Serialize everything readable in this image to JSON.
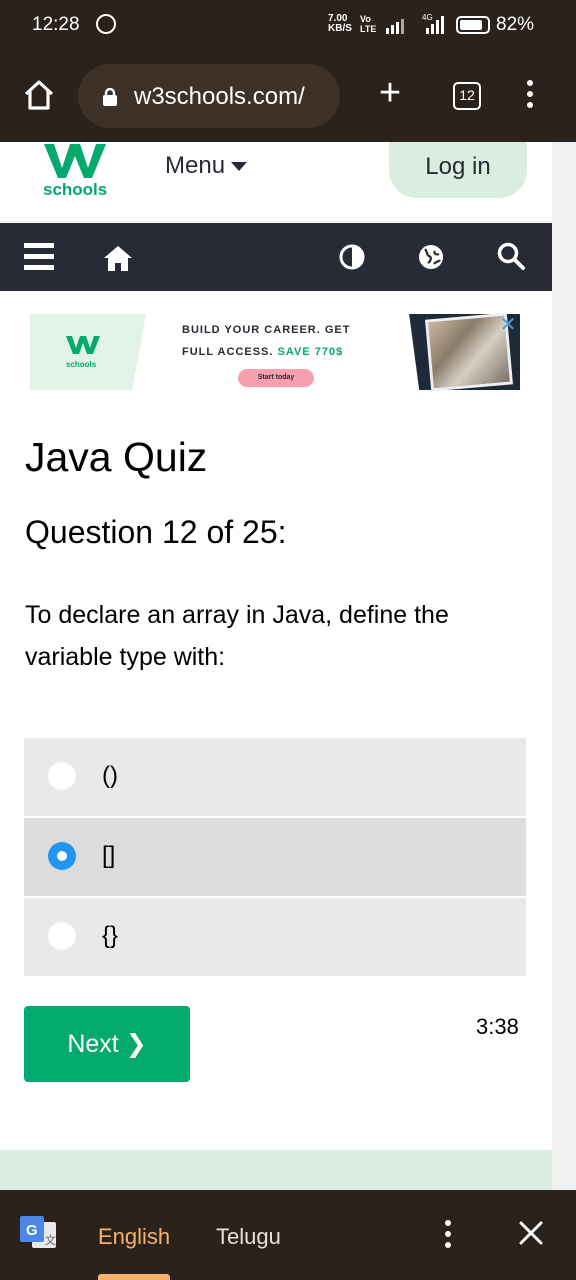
{
  "status_bar": {
    "time": "12:28",
    "net_speed_line1": "7.00",
    "net_speed_line2": "KB/S",
    "volte_line1": "Vo",
    "volte_line2": "LTE",
    "network_type": "4G",
    "battery": "82%"
  },
  "browser": {
    "url": "w3schools.com/",
    "tab_count": "12"
  },
  "site": {
    "logo_text": "schools",
    "menu_label": "Menu",
    "login_label": "Log in"
  },
  "ad": {
    "logo_text": "schools",
    "line1": "BUILD YOUR CAREER. GET",
    "line2_prefix": "FULL ACCESS.",
    "line2_highlight": "SAVE 770$",
    "cta": "Start today"
  },
  "quiz": {
    "title": "Java Quiz",
    "question_number": "Question 12 of 25:",
    "question_text": "To declare an array in Java, define the variable type with:",
    "options": [
      {
        "label": "()",
        "selected": false
      },
      {
        "label": "[]",
        "selected": true
      },
      {
        "label": "{}",
        "selected": false
      }
    ],
    "next_label": "Next ❯",
    "timer": "3:38"
  },
  "translate_bar": {
    "active_language": "English",
    "other_language": "Telugu"
  },
  "colors": {
    "w3_green": "#04aa6d",
    "dark_nav": "#282a35",
    "browser_chrome": "#2b221b",
    "radio_selected": "#2196f3",
    "active_lang": "#f6b26b"
  }
}
